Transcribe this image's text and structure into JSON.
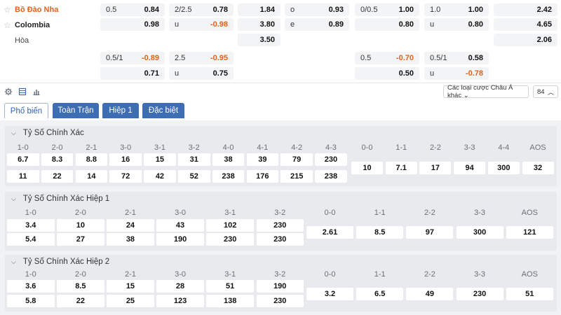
{
  "match": {
    "home": "Bồ Đào Nha",
    "away": "Colombia",
    "draw": "Hòa"
  },
  "markets": {
    "ft_hdp": {
      "main": {
        "home_h": "0.5",
        "home_v": "0.84",
        "away_v": "0.98"
      },
      "alt": {
        "home_h": "0.5/1",
        "home_v": "-0.89",
        "away_v": "0.71"
      }
    },
    "ft_ou": {
      "main": {
        "line": "2/2.5",
        "over_v": "0.78",
        "under_h": "u",
        "under_v": "-0.98"
      },
      "alt": {
        "line": "2.5",
        "over_v": "-0.95",
        "under_h": "u",
        "under_v": "0.75"
      }
    },
    "ft_1x2": {
      "home": "1.84",
      "away": "3.80",
      "draw": "3.50"
    },
    "ft_oe": {
      "odd_h": "o",
      "odd_v": "0.93",
      "even_h": "e",
      "even_v": "0.89"
    },
    "h1_hdp": {
      "main": {
        "home_h": "0/0.5",
        "home_v": "1.00",
        "away_v": "0.80"
      },
      "alt": {
        "home_h": "0.5",
        "home_v": "-0.70",
        "away_v": "0.50"
      }
    },
    "h1_ou": {
      "main": {
        "line": "1.0",
        "over_v": "1.00",
        "under_h": "u",
        "under_v": "0.80"
      },
      "alt": {
        "line": "0.5/1",
        "over_v": "0.58",
        "under_h": "u",
        "under_v": "-0.78"
      }
    },
    "h1_1x2": {
      "home": "2.42",
      "away": "4.65",
      "draw": "2.06"
    }
  },
  "toolbar": {
    "odds_type": "Các loại cược Châu Á khác ⌄",
    "count": "84"
  },
  "tabs": [
    "Phổ biến",
    "Toàn Trận",
    "Hiệp 1",
    "Đặc biệt"
  ],
  "sections": [
    {
      "title": "Tỷ Số Chính Xác",
      "home_scores": [
        "1-0",
        "2-0",
        "2-1",
        "3-0",
        "3-1",
        "3-2",
        "4-0",
        "4-1",
        "4-2",
        "4-3"
      ],
      "home_odds": [
        "6.7",
        "8.3",
        "8.8",
        "16",
        "15",
        "31",
        "38",
        "39",
        "79",
        "230"
      ],
      "away_odds": [
        "11",
        "22",
        "14",
        "72",
        "42",
        "52",
        "238",
        "176",
        "215",
        "238"
      ],
      "draw_scores": [
        "0-0",
        "1-1",
        "2-2",
        "3-3",
        "4-4",
        "AOS"
      ],
      "draw_odds": [
        "10",
        "7.1",
        "17",
        "94",
        "300",
        "32"
      ]
    },
    {
      "title": "Tỷ Số Chính Xác Hiệp 1",
      "home_scores": [
        "1-0",
        "2-0",
        "2-1",
        "3-0",
        "3-1",
        "3-2"
      ],
      "home_odds": [
        "3.4",
        "10",
        "24",
        "43",
        "102",
        "230"
      ],
      "away_odds": [
        "5.4",
        "27",
        "38",
        "190",
        "230",
        "230"
      ],
      "draw_scores": [
        "0-0",
        "1-1",
        "2-2",
        "3-3",
        "AOS"
      ],
      "draw_odds": [
        "2.61",
        "8.5",
        "97",
        "300",
        "121"
      ]
    },
    {
      "title": "Tỷ Số Chính Xác Hiệp 2",
      "home_scores": [
        "1-0",
        "2-0",
        "2-1",
        "3-0",
        "3-1",
        "3-2"
      ],
      "home_odds": [
        "3.6",
        "8.5",
        "15",
        "28",
        "51",
        "190"
      ],
      "away_odds": [
        "5.8",
        "22",
        "25",
        "123",
        "138",
        "230"
      ],
      "draw_scores": [
        "0-0",
        "1-1",
        "2-2",
        "3-3",
        "AOS"
      ],
      "draw_odds": [
        "3.2",
        "6.5",
        "49",
        "230",
        "51"
      ]
    }
  ],
  "icons": {
    "settings": "gear-icon",
    "list": "list-icon",
    "chart": "bar-chart-icon",
    "star": "star-icon",
    "collapse": "chevron-down-icon",
    "expand": "chevron-up-icon"
  },
  "colors": {
    "accent": "#3d6db3",
    "home_team": "#e0621b",
    "negative_odds": "#e0621b"
  }
}
